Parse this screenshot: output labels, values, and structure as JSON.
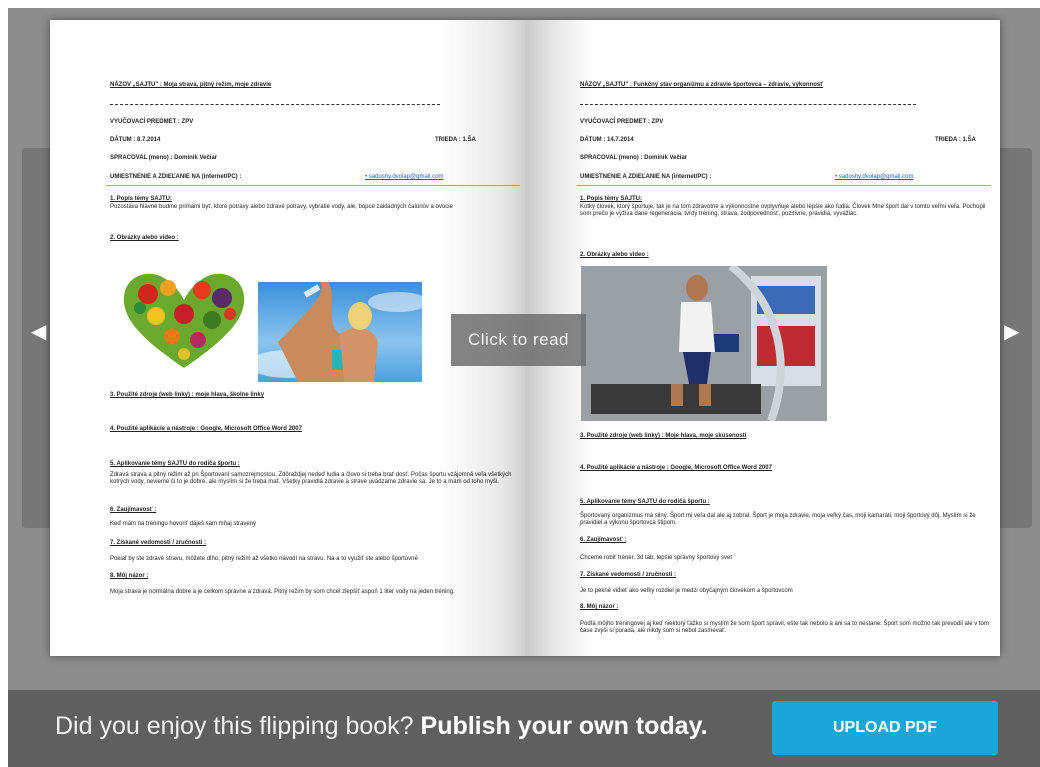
{
  "viewer": {
    "overlay_text": "Click to read",
    "prev_arrow": "◀",
    "next_arrow": "▶"
  },
  "left_page": {
    "title": "NÁZOV „SAJTU\" :   Moja strava, pitný režim, moje zdravie",
    "subject": "VYUČOVACÍ PREDMET : ZPV",
    "date": "DÁTUM :  8.7.2014",
    "class": "TRIEDA : 1.ŠA",
    "author": "SPRACOVAL (meno) : Dominik Večiar",
    "upload_label": "UMIESTNENIE A ZDIEĽANIE NA (internet/PC) :",
    "email": "• sadoshy.dvolap@gmail.com",
    "s1_head": "1. Popis témy SAJTU:",
    "s1_text": "Pozostáva hlavné budme primami  byť, ktoré potravy alebo zdravé potravy, vybratie vody, ale, bopce základných čalúnov a ovocie",
    "s2_head": "2. Obrázky alebo video :",
    "s3_head": "3. Použité zdroje (web linky) :  moje hlava, školne linky",
    "s4_head": "4. Použité aplikácie a nástroje :  Google, Microsoft  Office Word 2007",
    "s5_head": "5. Aplikovanie témy SAJTU do rodiča športu :",
    "s5_text": "Zdravá strava a pitný režim až pri Športovaní samozrejmostou. Zdôraždjej nedeď ludia a človo si treba brať dosť. Počas športu vzájomná veľa všetkých kotrých vody, nevieme či to je dobré, ale myslím si že treba mať. Všetky pravidlá zdravie a strave uvádzame zdravie sa. Je to a mám od toho myšl.",
    "s6_head": "6. Zaujímavosť :",
    "s6_text": "Keď mám na tréningu hovoriť dáješ sam mňaj stravený",
    "s7_head": "7. Získané vedomosti / zručnosti :",
    "s7_text": "Pokiaľ by ste zdravé stravu, môžete dlho, pitný režim až všetko návodí na stravu. Na a to využiť ste alebo športovné",
    "s8_head": "8. Môj názor :",
    "s8_text": "Moja strava je normálna dobre a je celkom správne a zdravá. Pitný režim by som chcel zlepšiť aspoň 1 liter vody na jeden tréning."
  },
  "right_page": {
    "title": "NÁZOV „SAJTU\" :   Funkčný stav organizmu a zdravie športovca – zdravie, výkonnosť",
    "subject": "VYUČOVACÍ PREDMET : ZPV",
    "date": "DÁTUM :  14.7.2014",
    "class": "TRIEDA : 1.ŠA",
    "author": "SPRACOVAL (meno) : Dominik Večiar",
    "upload_label": "UMIESTNENIE A ZDIEĽANIE NA (internet/PC) :",
    "email": "• sadoshy.dvolap@gmail.com",
    "s1_head": "1. Popis témy SAJTU:",
    "s1_text": "Kotký človek, ktorý športuje, tak je na tom zdravotne a výkonnostne ovplyvňuje alebo lepšie ako ľudia. Človek Mne šport dal v tomto veľmi veľa. Pochopil som prečo je výživa dane regenerácia, tvrdý tréning, strava, zodpovednosť, pozitívne, pravidlá, vyvážiac.",
    "s2_head": "2. Obrázky alebo video :",
    "s3_head": "3. Použité zdroje (web linky) :  Moje hlava, moje skúsenosti",
    "s4_head": "4. Použité aplikácie a nástroje :  Google, Microsoft  Office Word 2007",
    "s5_head": "5. Aplikovanie témy SAJTU do rodiča športu :",
    "s5_text": "Športovaný organizmus má silný. Šport mi veľa dal ale aj zobral. Šport je moja zdravie, moja veľký čas, moji kamaráti, moji športový dôj. Myslím si že pravidiel a výkonu športovca štipom.",
    "s6_head": "6. Zaujímavosť :",
    "s6_text": "Chceme robiť tréner, 3d tab, lepšie správny športový svet",
    "s7_head": "7. Získané vedomosti / zručnosti :",
    "s7_text": "Je to pekné vidieť ako veľký rozdiel je medzi obyčajným človekom a športovcom",
    "s8_head": "8. Môj názor :",
    "s8_text": "Podľa môjho tréningovej aj keď niektorý ťažko si myslím že som šport spravil, ešte tak nebolo a ani sa to nestane. Šport som možno tak prevodil ale v tom čase zvýši si porada, ale nikdy som si nebol zasmevať."
  },
  "footer": {
    "lead": "Did you enjoy this flipping book?",
    "cta": "Publish your own today.",
    "button": "UPLOAD PDF"
  },
  "colors": {
    "stage_bg": "#8d8d8d",
    "footer_bg": "#5f5f5f",
    "button_bg": "#1aa6d8"
  }
}
